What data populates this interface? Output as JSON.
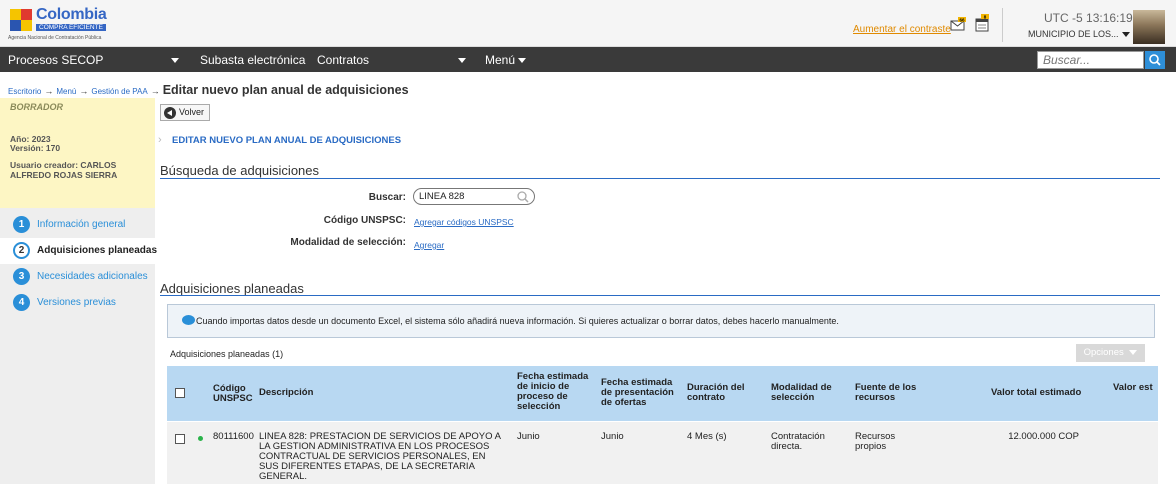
{
  "header": {
    "logo": {
      "brand": "Colombia",
      "tagline": "COMPRA EFICIENTE",
      "agency": "Agencia Nacional de Contratación Pública"
    },
    "contrast_link": "Aumentar el contraste",
    "mail_badge": "66",
    "cal_badge": "8",
    "timezone": "UTC -5",
    "time": "13:16:19",
    "municipality": "MUNICIPIO DE LOS..."
  },
  "nav": {
    "items": [
      "Procesos SECOP",
      "Subasta electrónica",
      "Contratos",
      "Menú"
    ],
    "search_placeholder": "Buscar..."
  },
  "breadcrumb": {
    "links": [
      "Escritorio",
      "Menú",
      "Gestión de PAA"
    ],
    "title": "Editar nuevo plan anual de adquisiciones"
  },
  "sidebar": {
    "status": "BORRADOR",
    "year": "Año: 2023",
    "version": "Versión: 170",
    "creator": "Usuario creador: CARLOS ALFREDO ROJAS SIERRA",
    "steps": [
      {
        "num": "1",
        "label": "Información general"
      },
      {
        "num": "2",
        "label": "Adquisiciones planeadas"
      },
      {
        "num": "3",
        "label": "Necesidades adicionales"
      },
      {
        "num": "4",
        "label": "Versiones previas"
      }
    ]
  },
  "main": {
    "back_label": "Volver",
    "edit_title": "EDITAR NUEVO PLAN ANUAL DE ADQUISICIONES",
    "search_section": {
      "title": "Búsqueda de adquisiciones",
      "buscar_label": "Buscar:",
      "buscar_value": "LINEA 828",
      "unspsc_label": "Código UNSPSC:",
      "unspsc_link": "Agregar códigos UNSPSC",
      "modalidad_label": "Modalidad de selección:",
      "modalidad_link": "Agregar"
    },
    "planned_section": {
      "title": "Adquisiciones planeadas",
      "info": "Cuando importas datos desde un documento Excel, el sistema sólo añadirá nueva información. Si quieres actualizar o borrar datos, debes hacerlo manualmente.",
      "count_label": "Adquisiciones planeadas (1)",
      "options_label": "Opciones"
    },
    "table": {
      "headers": {
        "code": "Código UNSPSC",
        "desc": "Descripción",
        "start": "Fecha estimada de inicio de proceso de selección",
        "offer": "Fecha estimada de presentación de ofertas",
        "duration": "Duración del contrato",
        "modality": "Modalidad de selección",
        "source": "Fuente de los recursos",
        "total": "Valor total estimado",
        "valor": "Valor est"
      },
      "rows": [
        {
          "code": "80111600",
          "desc": "LINEA 828: PRESTACION DE SERVICIOS DE APOYO A LA GESTION ADMINISTRATIVA EN LOS PROCESOS CONTRACTUAL DE SERVICIOS PERSONALES, EN SUS DIFERENTES ETAPAS, DE LA SECRETARIA GENERAL.",
          "start": "Junio",
          "offer": "Junio",
          "duration": "4 Mes (s)",
          "modality": "Contratación directa.",
          "source": "Recursos propios",
          "total": "12.000.000 COP"
        }
      ]
    }
  }
}
